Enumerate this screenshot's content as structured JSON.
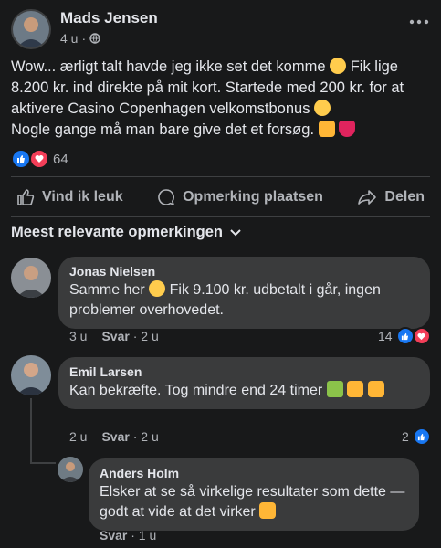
{
  "post": {
    "author": "Mads Jensen",
    "time": "4 u",
    "separator": "·",
    "more_icon": "more-horizontal-icon",
    "audience_icon": "globe-icon",
    "body_line1": "Wow... ærligt talt havde jeg ikke set det komme",
    "body_line1b": "Fik lige 8.200 kr. ind direkte på mit kort. Startede med 200 kr. for at aktivere Casino Copenhagen velkomstbonus",
    "body_line2": "Nogle gange må man bare give det et forsøg.",
    "reaction_count": "64"
  },
  "actions": {
    "like": "Vind ik leuk",
    "comment": "Opmerking plaatsen",
    "share": "Delen"
  },
  "comments_header": {
    "sort_label": "Meest relevante opmerkingen"
  },
  "comments": [
    {
      "name": "Jonas Nielsen",
      "text_a": "Samme her",
      "text_b": "Fik 9.100 kr. udbetalt i går, ingen problemer overhovedet.",
      "time": "3 u",
      "reply_label": "Svar",
      "reply_time": "· 2 u",
      "reaction_count": "14"
    },
    {
      "name": "Emil Larsen",
      "text_a": "Kan bekræfte. Tog mindre end 24 timer",
      "time": "2 u",
      "reply_label": "Svar",
      "reply_time": "· 2 u",
      "reaction_count": "2"
    },
    {
      "name": "Anders Holm",
      "text_a": "Elsker at se så virkelige resultater som dette — godt at vide at det virker",
      "reply_label": "Svar",
      "reply_time": "· 1 u"
    }
  ],
  "colors": {
    "background": "#18191a",
    "bubble": "#3a3b3c",
    "like_blue": "#1877f2",
    "love_red": "#f33e58"
  }
}
